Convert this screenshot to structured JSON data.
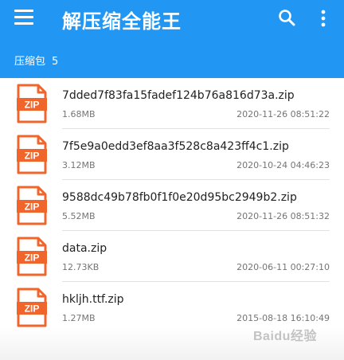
{
  "appbar": {
    "title": "解压缩全能王",
    "menu_icon": "menu-icon",
    "search_icon": "search-icon",
    "more_icon": "more-vert-icon",
    "color": "#2196F3"
  },
  "section": {
    "label": "压缩包",
    "count": "5"
  },
  "files": [
    {
      "icon_label": "ZIP",
      "name": "7dded7f83fa15fadef124b76a816d73a.zip",
      "size": "1.68MB",
      "date": "2020-11-26 08:51:22"
    },
    {
      "icon_label": "ZIP",
      "name": "7f5e9a0edd3ef8aa3f528c8a423ff4c1.zip",
      "size": "3.12MB",
      "date": "2020-10-24 04:46:23"
    },
    {
      "icon_label": "ZIP",
      "name": "9588dc49b78fb0f1f0e20d95bc2949b2.zip",
      "size": "5.52MB",
      "date": "2020-11-26 08:51:32"
    },
    {
      "icon_label": "ZIP",
      "name": "data.zip",
      "size": "12.73KB",
      "date": "2020-06-11 00:27:10"
    },
    {
      "icon_label": "ZIP",
      "name": "hkljh.ttf.zip",
      "size": "1.27MB",
      "date": "2015-08-18 16:10:49"
    }
  ],
  "zip_icon_color": "#F0652B",
  "watermark": "Baidu经验"
}
